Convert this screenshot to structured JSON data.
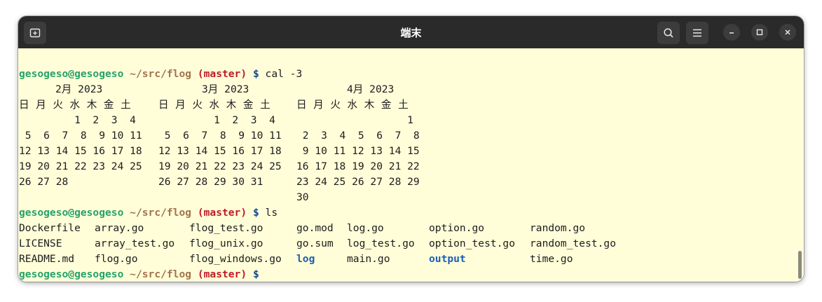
{
  "window": {
    "title": "端末",
    "new_tab_icon": "new-tab-icon",
    "search_icon": "search-icon",
    "menu_icon": "hamburger-menu-icon",
    "minimize_icon": "minimize-icon",
    "maximize_icon": "maximize-icon",
    "close_icon": "close-icon"
  },
  "prompt": {
    "user": "gesogeso@gesogeso",
    "path": "~/src/flog",
    "branch": "(master)",
    "symbol": "$"
  },
  "commands": [
    "cal -3",
    "ls",
    ""
  ],
  "calendar": {
    "headers": [
      "2月 2023",
      "3月 2023",
      "4月 2023"
    ],
    "weekdays": "日 月 火 水 木 金 土",
    "rows": [
      [
        "         1  2  3  4",
        "         1  2  3  4",
        "                  1"
      ],
      [
        " 5  6  7  8  9 10 11",
        " 5  6  7  8  9 10 11",
        " 2  3  4  5  6  7  8"
      ],
      [
        "12 13 14 15 16 17 18",
        "12 13 14 15 16 17 18",
        " 9 10 11 12 13 14 15"
      ],
      [
        "19 20 21 22 23 24 25",
        "19 20 21 22 23 24 25",
        "16 17 18 19 20 21 22"
      ],
      [
        "26 27 28",
        "26 27 28 29 30 31",
        "23 24 25 26 27 28 29"
      ],
      [
        "",
        "",
        "30"
      ]
    ]
  },
  "ls": {
    "rows": [
      [
        "Dockerfile",
        "array.go",
        "flog_test.go",
        "go.mod",
        "log.go",
        "option.go",
        "random.go"
      ],
      [
        "LICENSE",
        "array_test.go",
        "flog_unix.go",
        "go.sum",
        "log_test.go",
        "option_test.go",
        "random_test.go"
      ],
      [
        "README.md",
        "flog.go",
        "flog_windows.go",
        "log",
        "main.go",
        "output",
        "time.go"
      ]
    ],
    "directories": [
      "log",
      "output"
    ]
  },
  "colors": {
    "terminal_bg": "#fffed9",
    "titlebar_bg": "#2a2a2a",
    "user": "#26a269",
    "path": "#a2734c",
    "branch": "#c01c28",
    "directory": "#1a5fb4"
  }
}
